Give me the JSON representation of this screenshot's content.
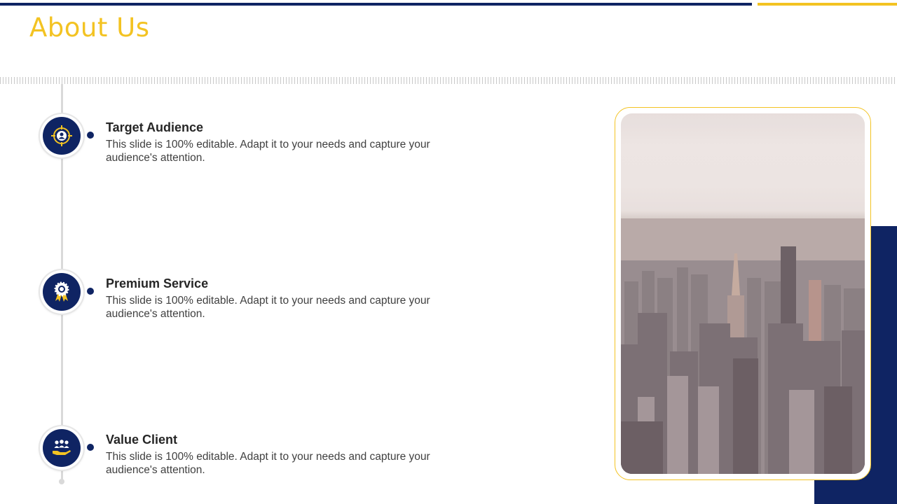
{
  "slide": {
    "title": "About Us"
  },
  "items": [
    {
      "heading": "Target Audience",
      "description": "This slide is 100% editable. Adapt it to your needs and capture your audience's attention.",
      "icon": "target-audience-icon"
    },
    {
      "heading": "Premium Service",
      "description": "This slide is 100% editable. Adapt it to your needs and capture your audience's attention.",
      "icon": "award-ribbon-icon"
    },
    {
      "heading": "Value Client",
      "description": "This slide is 100% editable. Adapt it to your needs and capture your audience's attention.",
      "icon": "hand-people-icon"
    }
  ],
  "image": {
    "subject": "city-skyline-photo"
  },
  "colors": {
    "navy": "#0f2463",
    "gold": "#f3c322",
    "heading_text": "#262626",
    "body_text": "#404040"
  }
}
